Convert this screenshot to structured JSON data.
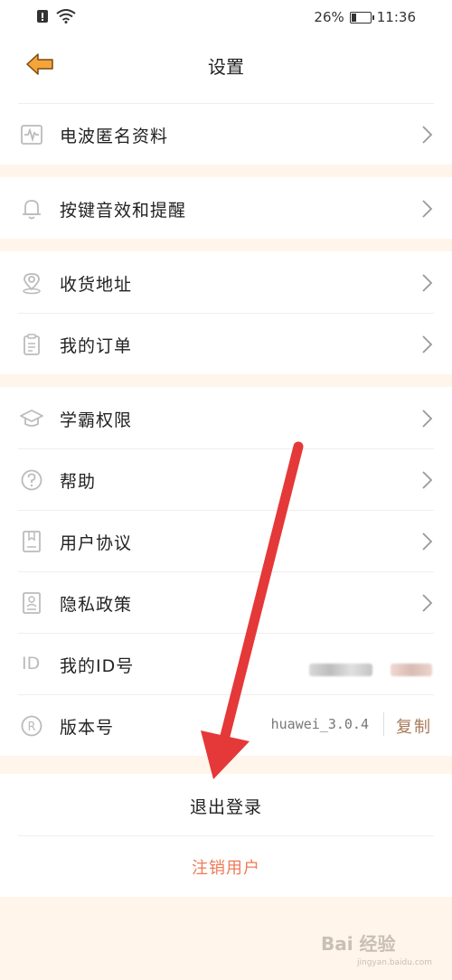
{
  "status_bar": {
    "battery_percent": "26%",
    "battery_level": 0.26,
    "time": "11:36",
    "icons": [
      "alert-icon",
      "wifi-icon",
      "battery-icon"
    ]
  },
  "header": {
    "title": "设置",
    "back_icon": "back-arrow-icon"
  },
  "menu": [
    {
      "label": "电波匿名资料",
      "icon": "pulse-icon"
    },
    {
      "label": "按键音效和提醒",
      "icon": "bell-icon"
    },
    {
      "label": "收货地址",
      "icon": "location-icon"
    },
    {
      "label": "我的订单",
      "icon": "clipboard-icon"
    },
    {
      "label": "学霸权限",
      "icon": "graduation-cap-icon"
    },
    {
      "label": "帮助",
      "icon": "help-icon"
    },
    {
      "label": "用户协议",
      "icon": "document-icon"
    },
    {
      "label": "隐私政策",
      "icon": "privacy-icon"
    },
    {
      "label": "我的ID号",
      "icon_text": "ID"
    },
    {
      "label": "版本号",
      "icon_text": "R",
      "value": "huawei_3.0.4",
      "action": "复制"
    }
  ],
  "actions": {
    "logout": "退出登录",
    "deregister": "注销用户"
  },
  "colors": {
    "accent": "#ee7a58",
    "section_gap": "#fff5ea",
    "back_arrow": "#f4a53a",
    "annotation_arrow": "#e53838",
    "copy_text": "#a87a58"
  },
  "watermark": {
    "text": "Bai 经验",
    "sub": "jingyan.baidu.com"
  }
}
